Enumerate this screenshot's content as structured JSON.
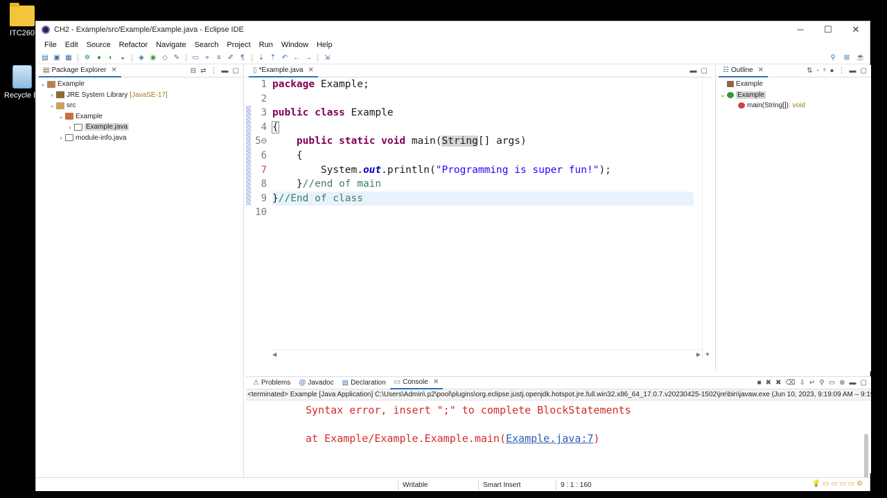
{
  "desktop": {
    "icons": [
      {
        "label": "ITC260",
        "icon": "folder-icon"
      },
      {
        "label": "Recycle Bi",
        "icon": "recycle-bin-icon"
      }
    ]
  },
  "window": {
    "title": "CH2 - Example/src/Example/Example.java - Eclipse IDE",
    "controls": {
      "minimize": "─",
      "maximize": "☐",
      "close": "✕"
    }
  },
  "menu": [
    "File",
    "Edit",
    "Source",
    "Refactor",
    "Navigate",
    "Search",
    "Project",
    "Run",
    "Window",
    "Help"
  ],
  "package_explorer": {
    "tab_label": "Package Explorer",
    "tree": [
      {
        "label": "Example",
        "indent": 0,
        "twisty": "⌄",
        "icon": "project-icon"
      },
      {
        "label": "JRE System Library",
        "suffix": "[JavaSE-17]",
        "indent": 1,
        "twisty": "›",
        "icon": "library-icon"
      },
      {
        "label": "src",
        "indent": 1,
        "twisty": "⌄",
        "icon": "source-folder-icon"
      },
      {
        "label": "Example",
        "indent": 2,
        "twisty": "⌄",
        "icon": "package-icon"
      },
      {
        "label": "Example.java",
        "indent": 3,
        "twisty": "›",
        "icon": "java-file-icon",
        "selected": true
      },
      {
        "label": "module-info.java",
        "indent": 2,
        "twisty": "›",
        "icon": "java-file-icon"
      }
    ]
  },
  "editor": {
    "tab_label": "*Example.java",
    "line_numbers": [
      "1",
      "2",
      "3",
      "4",
      "5⊖",
      "6",
      "7",
      "8",
      "9",
      "10"
    ],
    "current_line": 9
  },
  "outline": {
    "tab_label": "Outline",
    "items": [
      {
        "label": "Example",
        "indent": 0,
        "icon": "package-icon"
      },
      {
        "label": "Example",
        "indent": 0,
        "twisty": "⌄",
        "icon": "class-icon",
        "selected": true
      },
      {
        "label": "main(String[])",
        "type": " : void",
        "indent": 1,
        "icon": "method-icon"
      }
    ]
  },
  "bottom_tabs": {
    "problems": "Problems",
    "javadoc": "Javadoc",
    "declaration": "Declaration",
    "console": "Console"
  },
  "console": {
    "terminated": "<terminated> Example [Java Application] C:\\Users\\Admin\\.p2\\pool\\plugins\\org.eclipse.justj.openjdk.hotspot.jre.full.win32.x86_64_17.0.7.v20230425-1502\\jre\\bin\\javaw.exe  (Jun 10, 2023, 9:19:09 AM – 9:19:",
    "error_line": "Syntax error, insert \";\" to complete BlockStatements",
    "at_prefix": "at Example/Example.Example.main(",
    "at_link": "Example.java:7",
    "at_suffix": ")"
  },
  "status_bar": {
    "writable": "Writable",
    "insert_mode": "Smart Insert",
    "position": "9 : 1 : 160"
  },
  "colors": {
    "keyword": "#7f0055",
    "string": "#2a00ff",
    "comment": "#3f7f5f",
    "error": "#d42a2a",
    "current_line": "#e8f2fe"
  }
}
